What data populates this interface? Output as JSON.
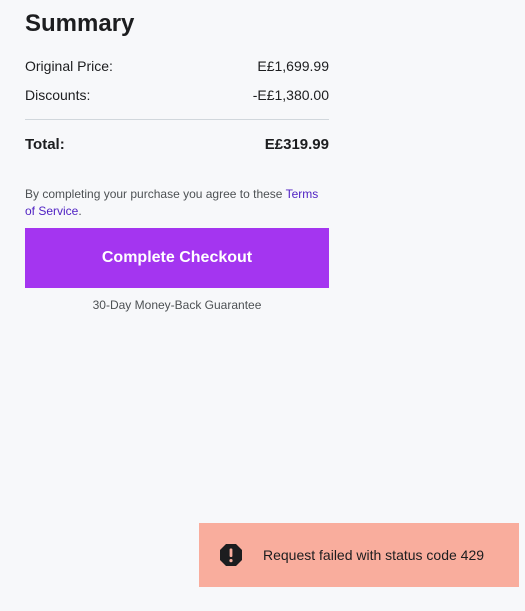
{
  "summary": {
    "title": "Summary",
    "original_price_label": "Original Price:",
    "original_price_value": "E£1,699.99",
    "discounts_label": "Discounts:",
    "discounts_value": "-E£1,380.00",
    "total_label": "Total:",
    "total_value": "E£319.99"
  },
  "terms": {
    "prefix": "By completing your purchase you agree to these ",
    "link_text": "Terms of Service",
    "suffix": "."
  },
  "checkout": {
    "button_label": "Complete Checkout",
    "guarantee": "30-Day Money-Back Guarantee"
  },
  "toast": {
    "icon": "error-octagon-icon",
    "message": "Request failed with status code 429"
  },
  "colors": {
    "accent": "#a435f0",
    "link": "#5022c3",
    "toast_background": "#f9ad9d",
    "page_background": "#f7f8fa"
  }
}
